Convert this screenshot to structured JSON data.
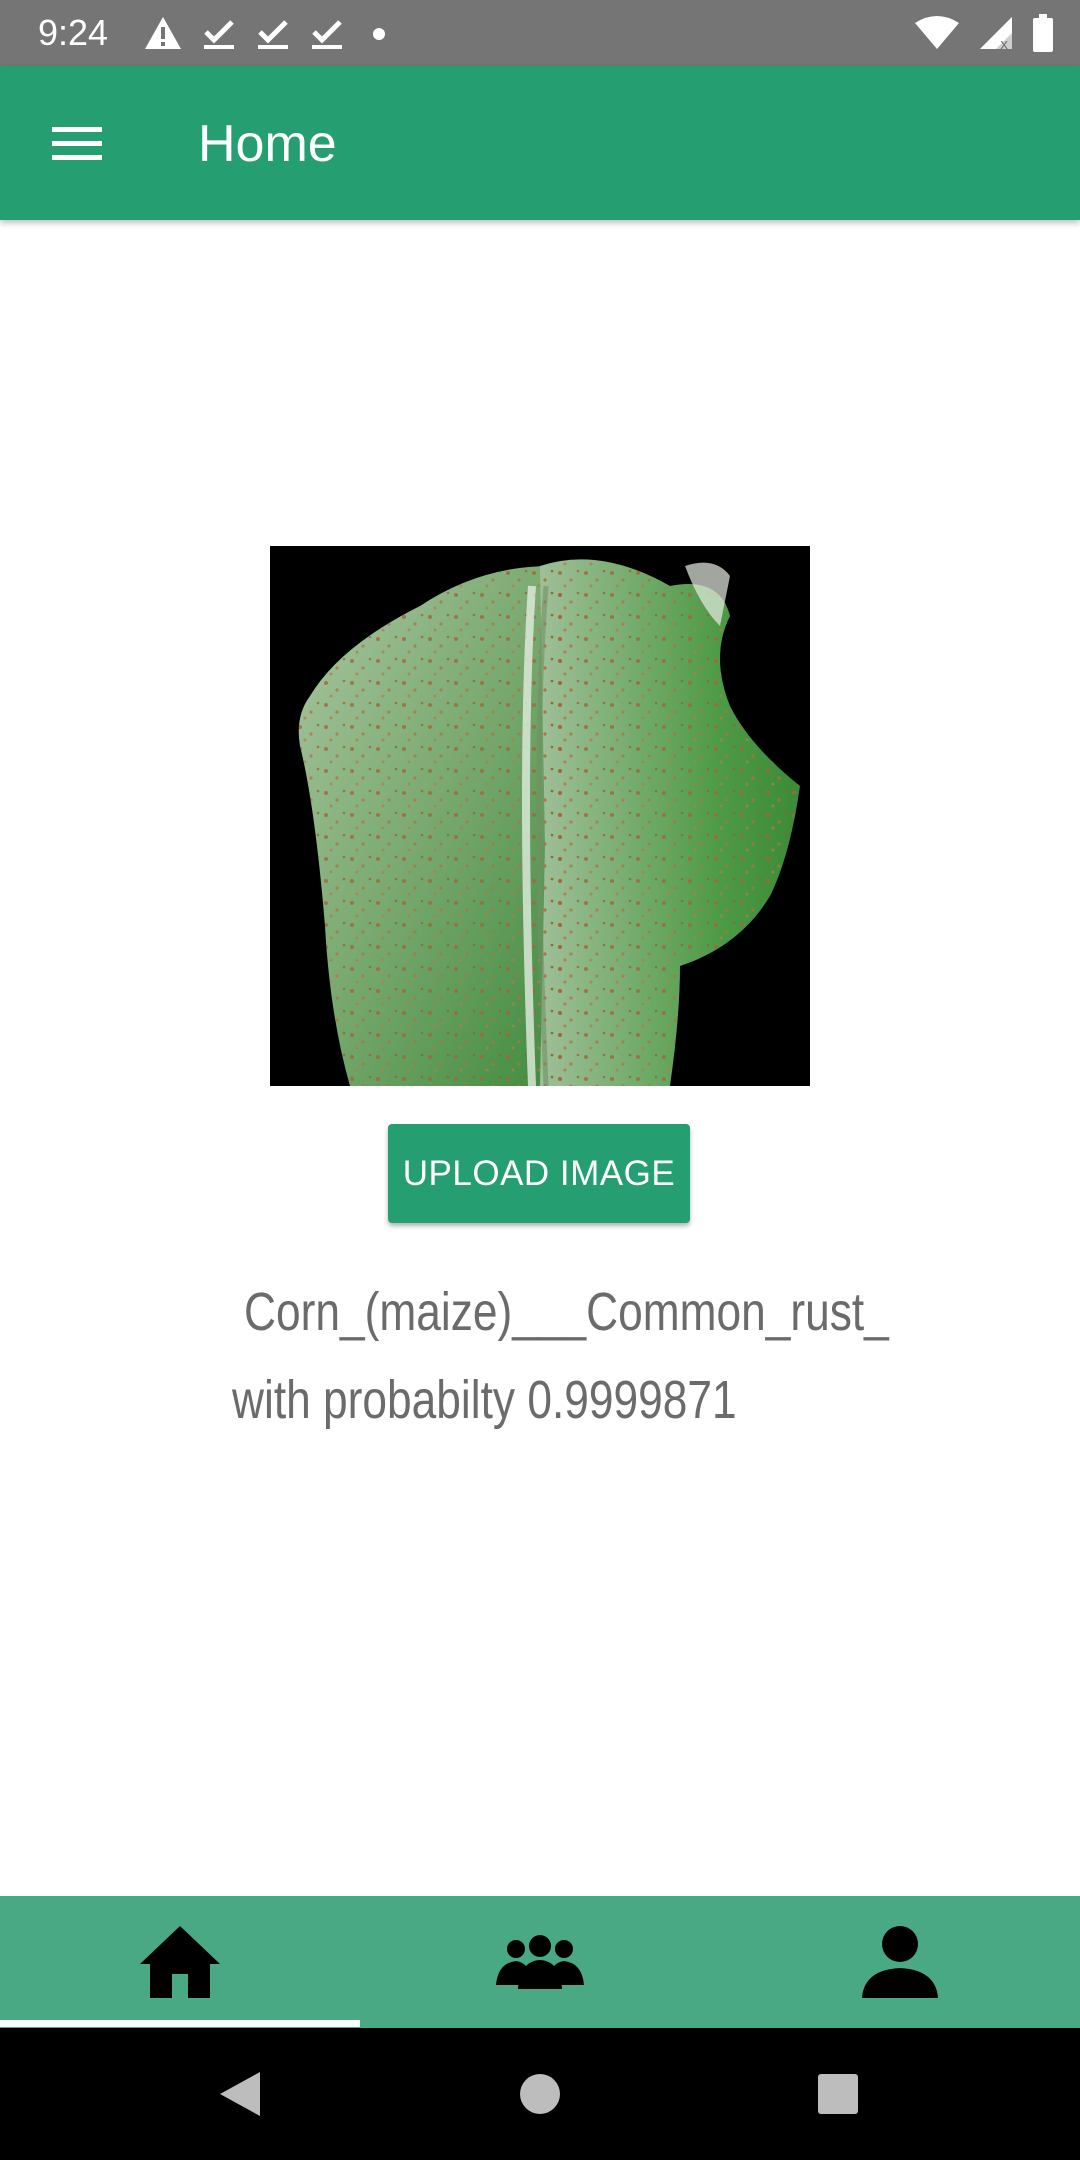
{
  "status_bar": {
    "time": "9:24",
    "left_icons": [
      "warning-icon",
      "check-icon",
      "check-icon",
      "check-icon",
      "dot-icon"
    ],
    "right_icons": [
      "wifi-icon",
      "signal-icon",
      "battery-icon"
    ]
  },
  "app_bar": {
    "title": "Home",
    "menu_icon": "menu-icon",
    "color": "#259e72"
  },
  "main": {
    "image_description_icon": "leaf-photo",
    "upload_button_label": "UPLOAD IMAGE",
    "result_class": "Corn_(maize)___Common_rust_",
    "result_probability": "with probabilty 0.9999871"
  },
  "bottom_nav": {
    "items": [
      {
        "icon": "home-icon",
        "selected": true
      },
      {
        "icon": "community-icon",
        "selected": false
      },
      {
        "icon": "profile-icon",
        "selected": false
      }
    ],
    "background": "#4aa985"
  },
  "system_nav": {
    "buttons": [
      "back-icon",
      "home-circle-icon",
      "recents-icon"
    ]
  }
}
